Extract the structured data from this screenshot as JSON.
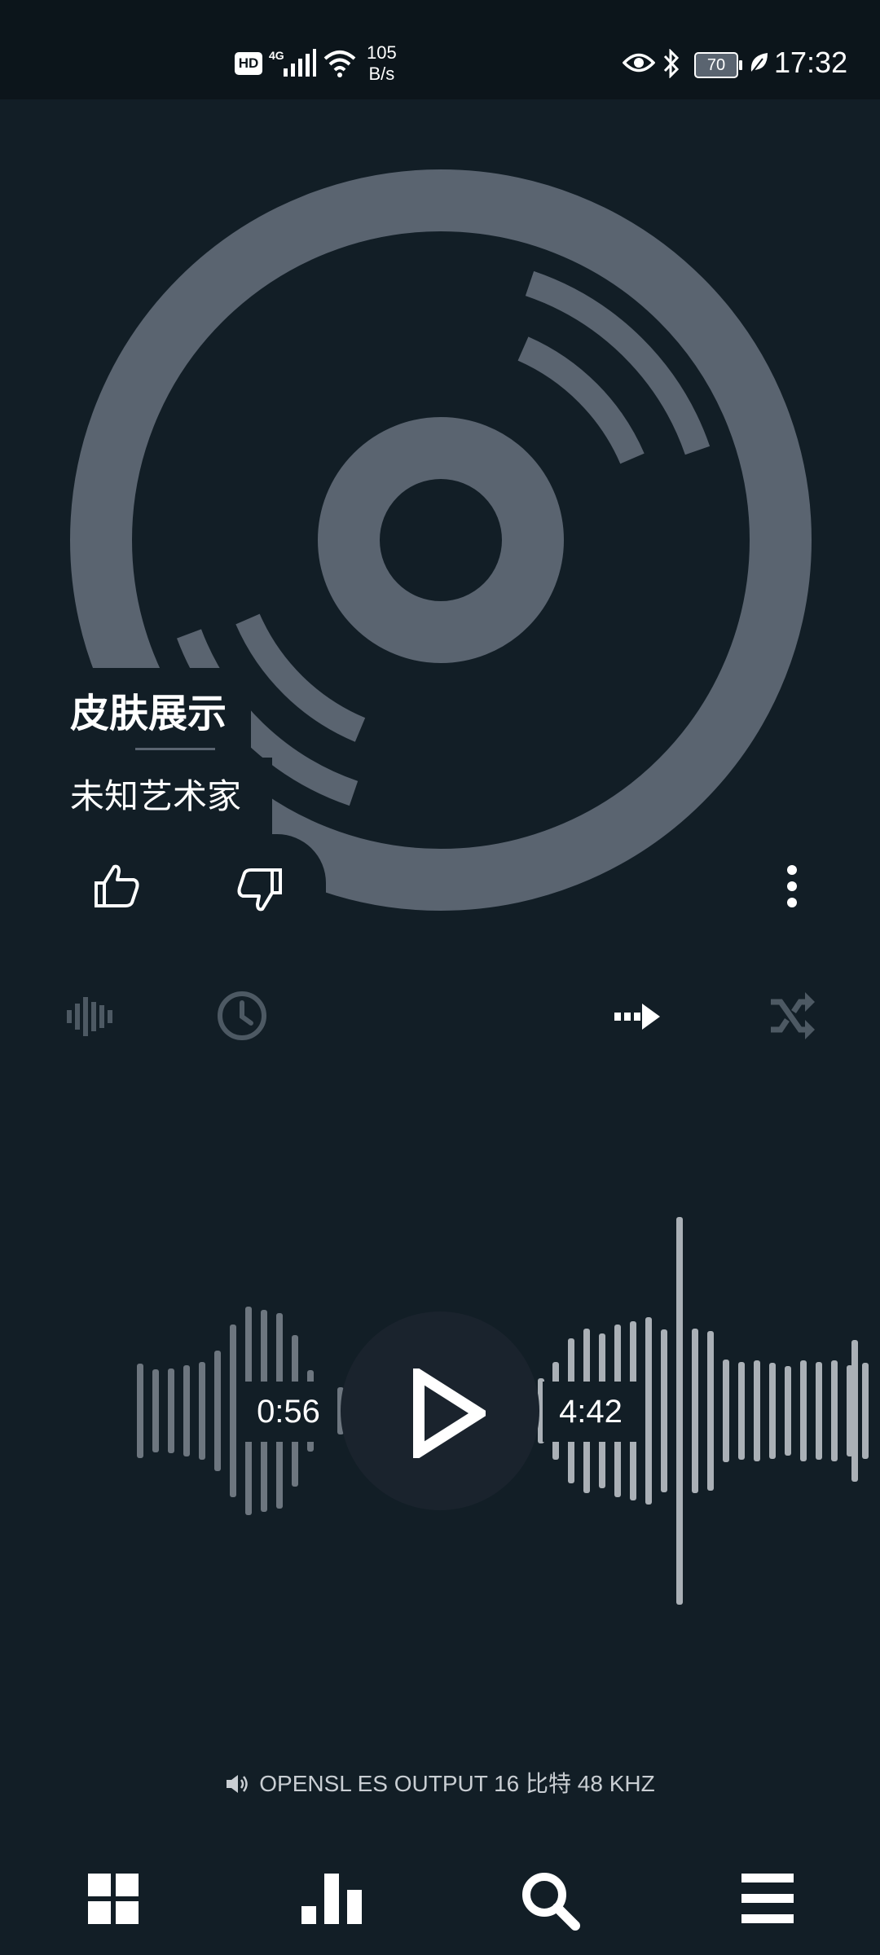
{
  "status_bar": {
    "hd_label": "HD",
    "network_label": "4G",
    "net_speed_value": "105",
    "net_speed_unit": "B/s",
    "battery": "70",
    "time": "17:32"
  },
  "track": {
    "title": "皮肤展示",
    "artist": "未知艺术家",
    "elapsed": "0:56",
    "total": "4:42"
  },
  "output_info": {
    "label": "OPENSL ES OUTPUT  16 比特  48 KHZ"
  },
  "icons": {
    "like": "thumb-up-icon",
    "dislike": "thumb-down-icon",
    "more": "more-vert-icon",
    "visualizer": "waveform-icon",
    "sleep_timer": "clock-icon",
    "repeat_mode": "arrow-right-dots-icon",
    "shuffle": "shuffle-icon",
    "play": "play-icon",
    "library": "grid-icon",
    "charts": "bar-chart-icon",
    "search": "search-icon",
    "menu": "menu-icon"
  },
  "colors": {
    "background": "#121e26",
    "disc": "#5a6470",
    "accent": "#ffffff",
    "muted": "#4d5963"
  }
}
